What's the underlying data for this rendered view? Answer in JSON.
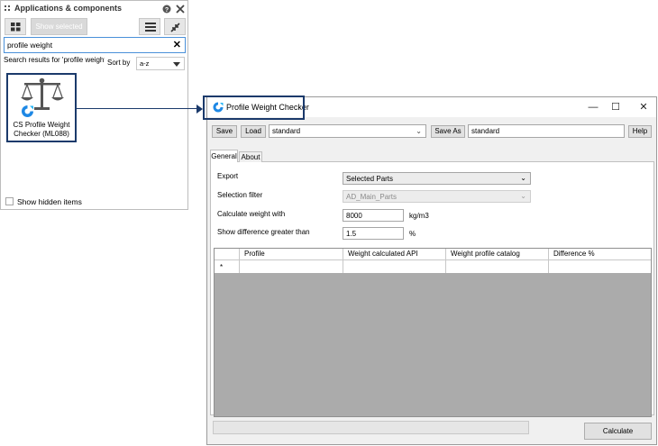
{
  "panel": {
    "title": "Applications & components",
    "toolbar": {
      "show_selected_label": "Show selected"
    },
    "search": {
      "value": "profile weight",
      "clear_glyph": "✕"
    },
    "results_label": "Search results for 'profile weight'",
    "sort": {
      "label": "Sort by",
      "value": "a-z"
    },
    "app_tile": {
      "name_line1": "CS Profile Weight",
      "name_line2": "Checker (ML088)",
      "icon": "scale-icon"
    },
    "show_hidden_label": "Show hidden items",
    "icons": [
      "help-icon",
      "close-icon",
      "grid-view-icon",
      "list-view-icon",
      "collapse-icon"
    ]
  },
  "window": {
    "title": "Profile Weight Checker",
    "controls": {
      "minimize": "—",
      "maximize": "☐",
      "close": "✕"
    },
    "toolbar": {
      "save_label": "Save",
      "load_label": "Load",
      "profile_value": "standard",
      "save_as_label": "Save As",
      "save_as_value": "standard",
      "help_label": "Help"
    },
    "tabs": [
      {
        "label": "General"
      },
      {
        "label": "About"
      }
    ],
    "form": {
      "export": {
        "label": "Export",
        "value": "Selected Parts"
      },
      "selection_filter": {
        "label": "Selection filter",
        "value": "AD_Main_Parts"
      },
      "calc_weight": {
        "label": "Calculate weight with",
        "value": "8000",
        "unit": "kg/m3"
      },
      "show_diff": {
        "label": "Show difference greater than",
        "value": "1.5",
        "unit": "%"
      }
    },
    "grid": {
      "columns": [
        "Profile",
        "Weight calculated API",
        "Weight profile catalog",
        "Difference %"
      ],
      "new_row_marker": "*"
    },
    "calculate_label": "Calculate"
  },
  "colors": {
    "highlight": "#1b3a6b",
    "accent": "#1e88e5",
    "grid_bg": "#ababab"
  }
}
